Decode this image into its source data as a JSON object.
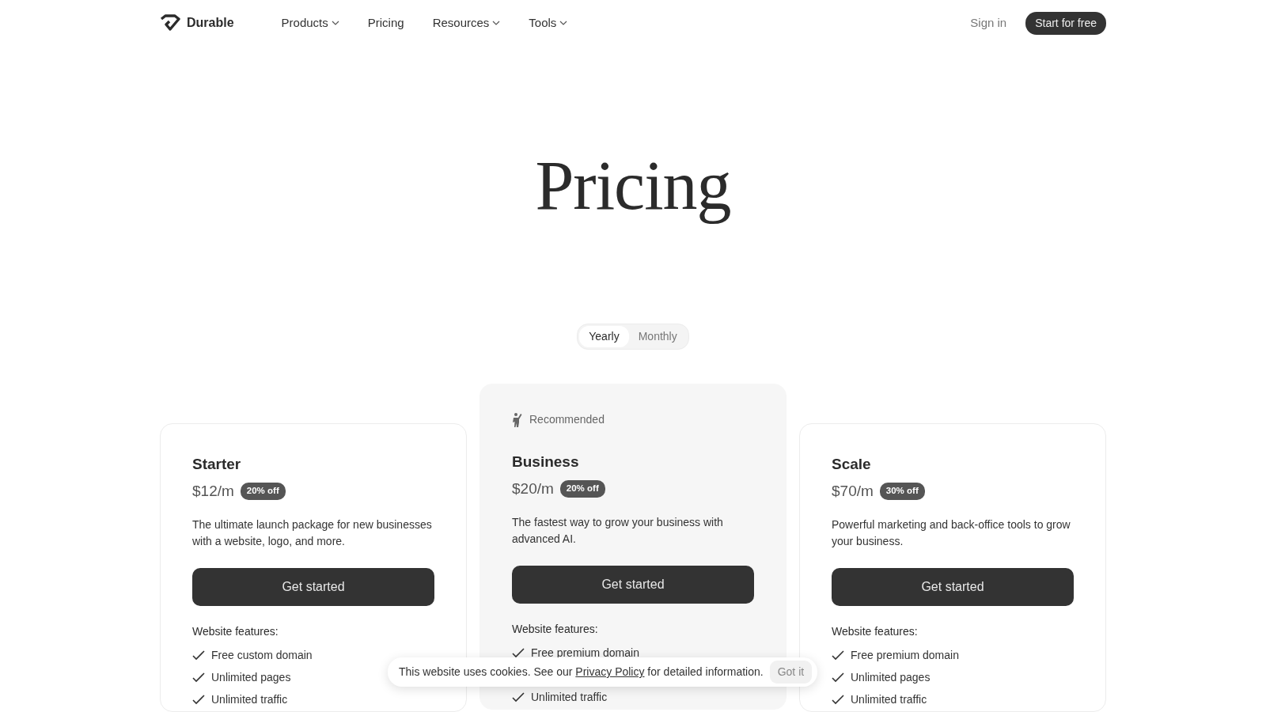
{
  "nav": {
    "brand": "Durable",
    "links": [
      {
        "label": "Products",
        "dropdown": true
      },
      {
        "label": "Pricing",
        "dropdown": false
      },
      {
        "label": "Resources",
        "dropdown": true
      },
      {
        "label": "Tools",
        "dropdown": true
      }
    ],
    "sign_in": "Sign in",
    "cta": "Start for free"
  },
  "hero": {
    "title": "Pricing"
  },
  "billing_toggle": [
    {
      "label": "Yearly",
      "selected": true
    },
    {
      "label": "Monthly",
      "selected": false
    }
  ],
  "plans": [
    {
      "name": "Starter",
      "recommended": false,
      "price": "$12/m",
      "discount": "20% off",
      "description": "The ultimate launch package for new businesses with a website, logo, and more.",
      "button": "Get started",
      "features_heading": "Website features:",
      "features": [
        {
          "kind": "check",
          "text": "Free custom domain"
        },
        {
          "kind": "check",
          "text": "Unlimited pages"
        },
        {
          "kind": "check",
          "text": "Unlimited traffic"
        }
      ]
    },
    {
      "name": "Business",
      "recommended": true,
      "badge": "Recommended",
      "price": "$20/m",
      "discount": "20% off",
      "description": "The fastest way to grow your business with advanced AI.",
      "button": "Get started",
      "features_heading": "Website features:",
      "features": [
        {
          "kind": "check",
          "text": "Free premium domain"
        },
        {
          "kind": "covered"
        },
        {
          "kind": "check",
          "text": "Unlimited traffic"
        }
      ]
    },
    {
      "name": "Scale",
      "recommended": false,
      "price": "$70/m",
      "discount": "30% off",
      "description": "Powerful marketing and back-office tools to grow your business.",
      "button": "Get started",
      "features_heading": "Website features:",
      "features": [
        {
          "kind": "check",
          "text": "Free premium domain"
        },
        {
          "kind": "check",
          "text": "Unlimited pages"
        },
        {
          "kind": "check",
          "text": "Unlimited traffic"
        }
      ]
    }
  ],
  "cookie_banner": {
    "text_before": "This website uses cookies. See our",
    "link": "Privacy Policy",
    "text_after": "for detailed information.",
    "button": "Got it"
  }
}
